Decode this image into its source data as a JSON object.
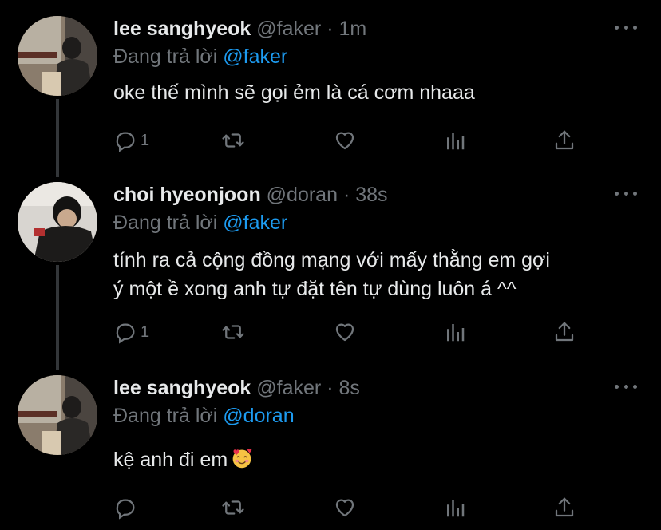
{
  "tweets": [
    {
      "name": "lee sanghyeok",
      "handle": "@faker",
      "dot": "·",
      "time": "1m",
      "replying_prefix": "Đang trả lời",
      "replying_to": "@faker",
      "text_lines": [
        "oke thế mình sẽ gọi ẻm là cá cơm nhaaa"
      ],
      "reply_count": "1",
      "avatar_icon": "avatar-photo-faker"
    },
    {
      "name": "choi hyeonjoon",
      "handle": "@doran",
      "dot": "·",
      "time": "38s",
      "replying_prefix": "Đang trả lời",
      "replying_to": "@faker",
      "text_lines": [
        "tính ra cả cộng đồng mạng với mấy thằng em gợi",
        "ý một ề xong anh tự đặt tên tự dùng luôn á ^^"
      ],
      "reply_count": "1",
      "avatar_icon": "avatar-photo-doran"
    },
    {
      "name": "lee sanghyeok",
      "handle": "@faker",
      "dot": "·",
      "time": "8s",
      "replying_prefix": "Đang trả lời",
      "replying_to": "@doran",
      "text_lines": [
        "kệ anh đi em"
      ],
      "reply_count": "",
      "emoji": "smiling-face-with-hearts-emoji"
    }
  ],
  "colors": {
    "background": "#000000",
    "primary_text": "#e7e9ea",
    "secondary_text": "#71767b",
    "link": "#1d9bf0",
    "thread_line": "#333639"
  },
  "icons": [
    "reply-icon",
    "retweet-icon",
    "like-icon",
    "analytics-icon",
    "share-icon",
    "more-icon"
  ]
}
